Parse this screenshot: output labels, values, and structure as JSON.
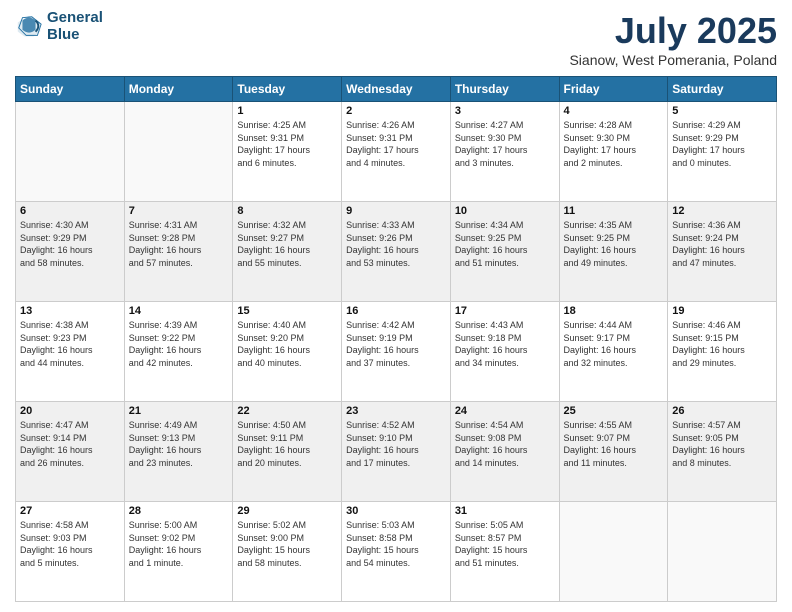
{
  "header": {
    "logo_line1": "General",
    "logo_line2": "Blue",
    "month": "July 2025",
    "location": "Sianow, West Pomerania, Poland"
  },
  "days_of_week": [
    "Sunday",
    "Monday",
    "Tuesday",
    "Wednesday",
    "Thursday",
    "Friday",
    "Saturday"
  ],
  "weeks": [
    [
      {
        "day": "",
        "info": ""
      },
      {
        "day": "",
        "info": ""
      },
      {
        "day": "1",
        "info": "Sunrise: 4:25 AM\nSunset: 9:31 PM\nDaylight: 17 hours\nand 6 minutes."
      },
      {
        "day": "2",
        "info": "Sunrise: 4:26 AM\nSunset: 9:31 PM\nDaylight: 17 hours\nand 4 minutes."
      },
      {
        "day": "3",
        "info": "Sunrise: 4:27 AM\nSunset: 9:30 PM\nDaylight: 17 hours\nand 3 minutes."
      },
      {
        "day": "4",
        "info": "Sunrise: 4:28 AM\nSunset: 9:30 PM\nDaylight: 17 hours\nand 2 minutes."
      },
      {
        "day": "5",
        "info": "Sunrise: 4:29 AM\nSunset: 9:29 PM\nDaylight: 17 hours\nand 0 minutes."
      }
    ],
    [
      {
        "day": "6",
        "info": "Sunrise: 4:30 AM\nSunset: 9:29 PM\nDaylight: 16 hours\nand 58 minutes."
      },
      {
        "day": "7",
        "info": "Sunrise: 4:31 AM\nSunset: 9:28 PM\nDaylight: 16 hours\nand 57 minutes."
      },
      {
        "day": "8",
        "info": "Sunrise: 4:32 AM\nSunset: 9:27 PM\nDaylight: 16 hours\nand 55 minutes."
      },
      {
        "day": "9",
        "info": "Sunrise: 4:33 AM\nSunset: 9:26 PM\nDaylight: 16 hours\nand 53 minutes."
      },
      {
        "day": "10",
        "info": "Sunrise: 4:34 AM\nSunset: 9:25 PM\nDaylight: 16 hours\nand 51 minutes."
      },
      {
        "day": "11",
        "info": "Sunrise: 4:35 AM\nSunset: 9:25 PM\nDaylight: 16 hours\nand 49 minutes."
      },
      {
        "day": "12",
        "info": "Sunrise: 4:36 AM\nSunset: 9:24 PM\nDaylight: 16 hours\nand 47 minutes."
      }
    ],
    [
      {
        "day": "13",
        "info": "Sunrise: 4:38 AM\nSunset: 9:23 PM\nDaylight: 16 hours\nand 44 minutes."
      },
      {
        "day": "14",
        "info": "Sunrise: 4:39 AM\nSunset: 9:22 PM\nDaylight: 16 hours\nand 42 minutes."
      },
      {
        "day": "15",
        "info": "Sunrise: 4:40 AM\nSunset: 9:20 PM\nDaylight: 16 hours\nand 40 minutes."
      },
      {
        "day": "16",
        "info": "Sunrise: 4:42 AM\nSunset: 9:19 PM\nDaylight: 16 hours\nand 37 minutes."
      },
      {
        "day": "17",
        "info": "Sunrise: 4:43 AM\nSunset: 9:18 PM\nDaylight: 16 hours\nand 34 minutes."
      },
      {
        "day": "18",
        "info": "Sunrise: 4:44 AM\nSunset: 9:17 PM\nDaylight: 16 hours\nand 32 minutes."
      },
      {
        "day": "19",
        "info": "Sunrise: 4:46 AM\nSunset: 9:15 PM\nDaylight: 16 hours\nand 29 minutes."
      }
    ],
    [
      {
        "day": "20",
        "info": "Sunrise: 4:47 AM\nSunset: 9:14 PM\nDaylight: 16 hours\nand 26 minutes."
      },
      {
        "day": "21",
        "info": "Sunrise: 4:49 AM\nSunset: 9:13 PM\nDaylight: 16 hours\nand 23 minutes."
      },
      {
        "day": "22",
        "info": "Sunrise: 4:50 AM\nSunset: 9:11 PM\nDaylight: 16 hours\nand 20 minutes."
      },
      {
        "day": "23",
        "info": "Sunrise: 4:52 AM\nSunset: 9:10 PM\nDaylight: 16 hours\nand 17 minutes."
      },
      {
        "day": "24",
        "info": "Sunrise: 4:54 AM\nSunset: 9:08 PM\nDaylight: 16 hours\nand 14 minutes."
      },
      {
        "day": "25",
        "info": "Sunrise: 4:55 AM\nSunset: 9:07 PM\nDaylight: 16 hours\nand 11 minutes."
      },
      {
        "day": "26",
        "info": "Sunrise: 4:57 AM\nSunset: 9:05 PM\nDaylight: 16 hours\nand 8 minutes."
      }
    ],
    [
      {
        "day": "27",
        "info": "Sunrise: 4:58 AM\nSunset: 9:03 PM\nDaylight: 16 hours\nand 5 minutes."
      },
      {
        "day": "28",
        "info": "Sunrise: 5:00 AM\nSunset: 9:02 PM\nDaylight: 16 hours\nand 1 minute."
      },
      {
        "day": "29",
        "info": "Sunrise: 5:02 AM\nSunset: 9:00 PM\nDaylight: 15 hours\nand 58 minutes."
      },
      {
        "day": "30",
        "info": "Sunrise: 5:03 AM\nSunset: 8:58 PM\nDaylight: 15 hours\nand 54 minutes."
      },
      {
        "day": "31",
        "info": "Sunrise: 5:05 AM\nSunset: 8:57 PM\nDaylight: 15 hours\nand 51 minutes."
      },
      {
        "day": "",
        "info": ""
      },
      {
        "day": "",
        "info": ""
      }
    ]
  ]
}
